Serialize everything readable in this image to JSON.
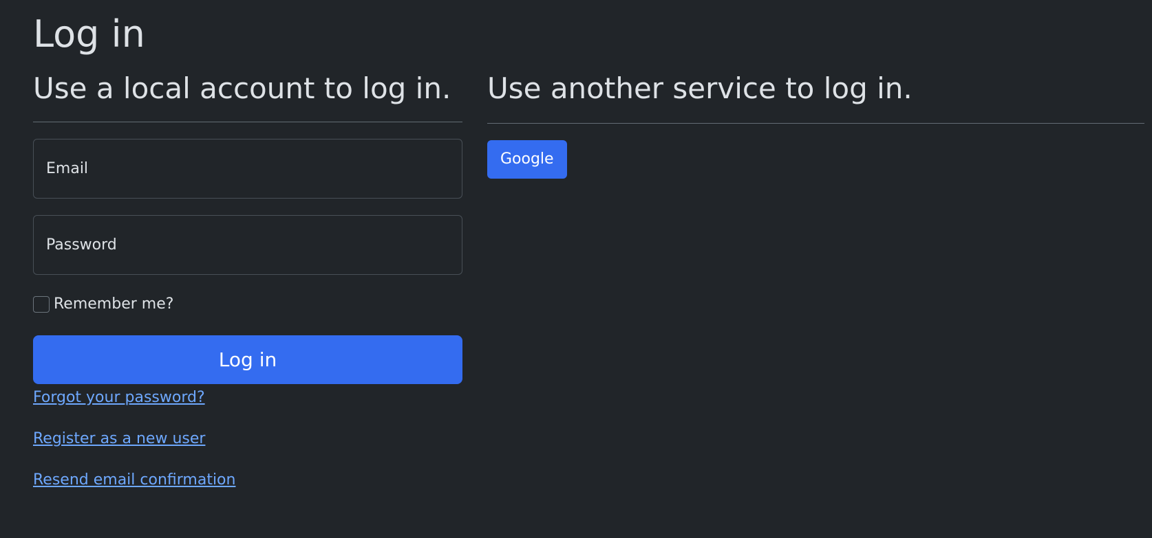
{
  "page": {
    "title": "Log in"
  },
  "local": {
    "heading": "Use a local account to log in.",
    "email_placeholder": "Email",
    "password_placeholder": "Password",
    "remember_label": "Remember me?",
    "remember_checked": false,
    "submit_label": "Log in",
    "links": {
      "forgot": "Forgot your password?",
      "register": "Register as a new user",
      "resend": "Resend email confirmation"
    }
  },
  "external": {
    "heading": "Use another service to log in.",
    "providers": [
      {
        "label": "Google"
      }
    ]
  },
  "colors": {
    "background": "#212529",
    "text": "#dee2e6",
    "primary": "#346cf0",
    "link": "#6ea8fe"
  }
}
